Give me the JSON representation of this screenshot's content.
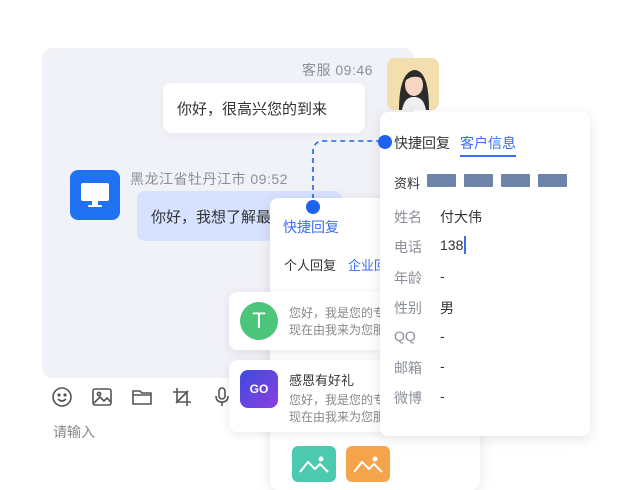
{
  "chat": {
    "agent_meta": "客服 09:46",
    "agent_message": "你好，很高兴您的到来",
    "visitor_meta": "黑龙江省牡丹江市 09:52",
    "visitor_message": "你好，我想了解最新",
    "input_placeholder": "请输入",
    "toolbar_icons": [
      "emoji-icon",
      "image-icon",
      "folder-icon",
      "crop-icon",
      "microphone-icon"
    ]
  },
  "quick_reply": {
    "title": "快捷回复",
    "tabs": [
      "个人回复",
      "企业回复"
    ],
    "cards": [
      {
        "icon_letter": "T",
        "title": "",
        "lines": [
          "您好，我是您的专属客服",
          "现在由我来为您服务"
        ]
      },
      {
        "icon_letter": "GO",
        "title": "感恩有好礼",
        "lines": [
          "您好，我是您的专属客服",
          "现在由我来为您服务"
        ]
      }
    ]
  },
  "customer_info": {
    "tabs": [
      "快捷回复",
      "客户信息"
    ],
    "profile_label": "资料",
    "fields": [
      {
        "label": "姓名",
        "value": "付大伟"
      },
      {
        "label": "电话",
        "value": "138"
      },
      {
        "label": "年龄",
        "value": "-"
      },
      {
        "label": "性别",
        "value": "男"
      },
      {
        "label": "QQ",
        "value": "-"
      },
      {
        "label": "邮箱",
        "value": "-"
      },
      {
        "label": "微博",
        "value": "-"
      }
    ]
  },
  "colors": {
    "accent": "#3a6cf4",
    "visitor_bubble": "#d6e2ff",
    "chat_background": "#f1f2f8",
    "profile_bar": "#6d84a8"
  }
}
